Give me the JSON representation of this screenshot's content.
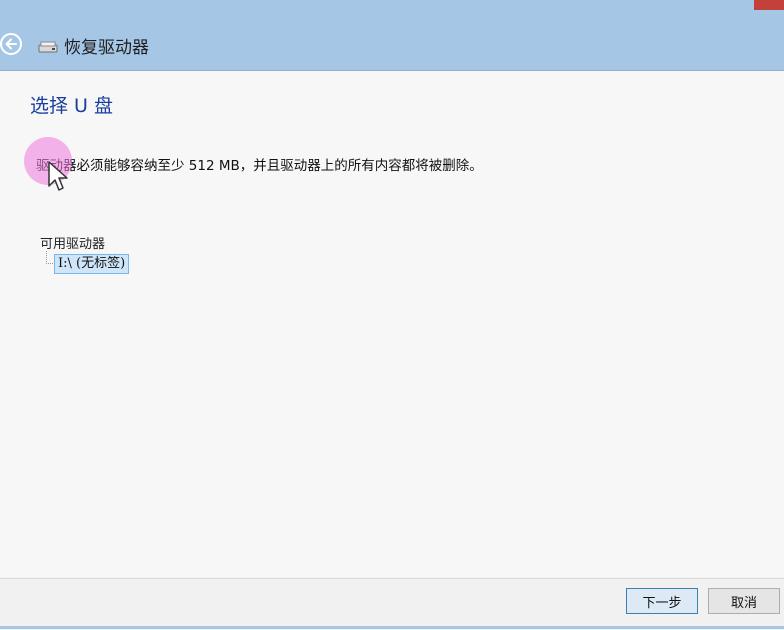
{
  "window": {
    "title": "恢复驱动器",
    "back_icon": "back-arrow-icon",
    "drive_icon": "drive-icon"
  },
  "page": {
    "heading": "选择 U 盘",
    "description": "驱动器必须能够容纳至少 512 MB，并且驱动器上的所有内容都将被删除。"
  },
  "drives": {
    "label": "可用驱动器",
    "items": [
      {
        "label": "I:\\ (无标签)",
        "selected": true
      }
    ]
  },
  "footer": {
    "next_label": "下一步",
    "cancel_label": "取消"
  },
  "colors": {
    "titlebar": "#a6c6e6",
    "heading": "#1b3d9e",
    "selection": "#cfe6fa",
    "close_button": "#c4413a"
  }
}
